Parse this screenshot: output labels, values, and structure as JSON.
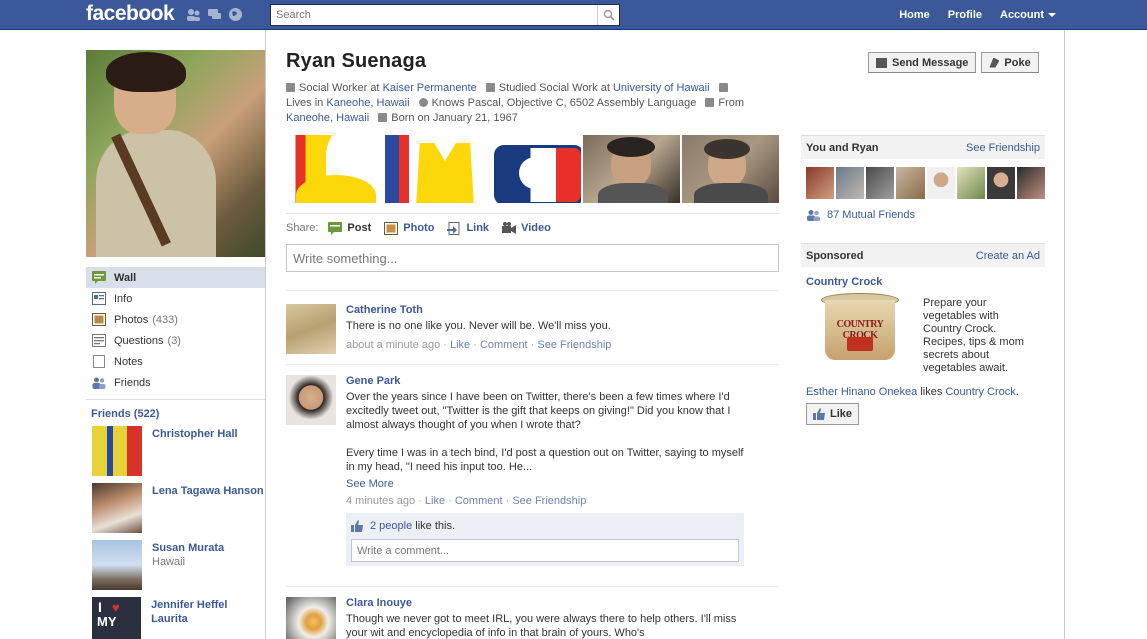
{
  "topbar": {
    "logo": "facebook",
    "search_placeholder": "Search",
    "nav": [
      "Home",
      "Profile",
      "Account"
    ]
  },
  "profile": {
    "name": "Ryan Suenaga",
    "info_parts": {
      "work_prefix": "Social Worker at ",
      "work_place": "Kaiser Permanente",
      "study_prefix": "Studied Social Work at ",
      "study_place": "University of Hawaii",
      "lives_prefix": "Lives in ",
      "lives_place": "Kaneohe, Hawaii",
      "knows": "Knows Pascal, Objective C, 6502 Assembly Language",
      "from_prefix": "From",
      "from_place": "Kaneohe, Hawaii",
      "born": "Born on January 21, 1967"
    },
    "buttons": {
      "message": "Send Message",
      "poke": "Poke"
    }
  },
  "menu": [
    {
      "label": "Wall",
      "count": ""
    },
    {
      "label": "Info",
      "count": ""
    },
    {
      "label": "Photos",
      "count": "(433)"
    },
    {
      "label": "Questions",
      "count": "(3)"
    },
    {
      "label": "Notes",
      "count": ""
    },
    {
      "label": "Friends",
      "count": ""
    }
  ],
  "friends": {
    "header": "Friends (522)",
    "list": [
      {
        "name": "Christopher Hall",
        "sub": ""
      },
      {
        "name": "Lena Tagawa Hanson",
        "sub": ""
      },
      {
        "name": "Susan Murata",
        "sub": "Hawaii"
      },
      {
        "name": "Jennifer Heffel Laurita",
        "sub": ""
      }
    ]
  },
  "share": {
    "label": "Share:",
    "items": [
      "Post",
      "Photo",
      "Link",
      "Video"
    ],
    "placeholder": "Write something..."
  },
  "stories": [
    {
      "name": "Catherine Toth",
      "text": "There is no one like you. Never will be. We'll miss you.",
      "time": "about a minute ago",
      "links": [
        "Like",
        "Comment",
        "See Friendship"
      ]
    },
    {
      "name": "Gene Park",
      "text1": "Over the years since I have been on Twitter, there's been a few times where I'd excitedly tweet out, \"Twitter is the gift that keeps on giving!\" Did you know that I almost always thought of you when I wrote that?",
      "text2": "Every time I was in a tech bind, I'd post a question out on Twitter, saying to myself in my head, \"I need his input too. He...",
      "see_more": "See More",
      "time": "4 minutes ago",
      "links": [
        "Like",
        "Comment",
        "See Friendship"
      ],
      "likes_people": "2 people",
      "likes_suffix": " like this.",
      "comment_placeholder": "Write a comment..."
    },
    {
      "name": "Clara Inouye",
      "text": "Though we never got to meet IRL, you were always there to help others. I'll miss your wit and encyclopedia of info in that brain of yours. Who's"
    }
  ],
  "right": {
    "friendship_header": "You and Ryan",
    "friendship_link": "See Friendship",
    "mutual": "87 Mutual Friends",
    "sponsored_header": "Sponsored",
    "create_ad": "Create an Ad",
    "ad_title": "Country Crock",
    "ad_text": "Prepare your vegetables with Country Crock. Recipes, tips & mom secrets about vegetables await.",
    "ad_brand_label": "COUNTRY CROCK",
    "ad_liker": "Esther Hinano Onekea",
    "ad_likes_word": " likes ",
    "ad_liked": "Country Crock",
    "ad_like_button": "Like"
  },
  "colors": {
    "brand": "#3b5998",
    "link": "#3b5998",
    "meta_link": "#6d84b4"
  }
}
